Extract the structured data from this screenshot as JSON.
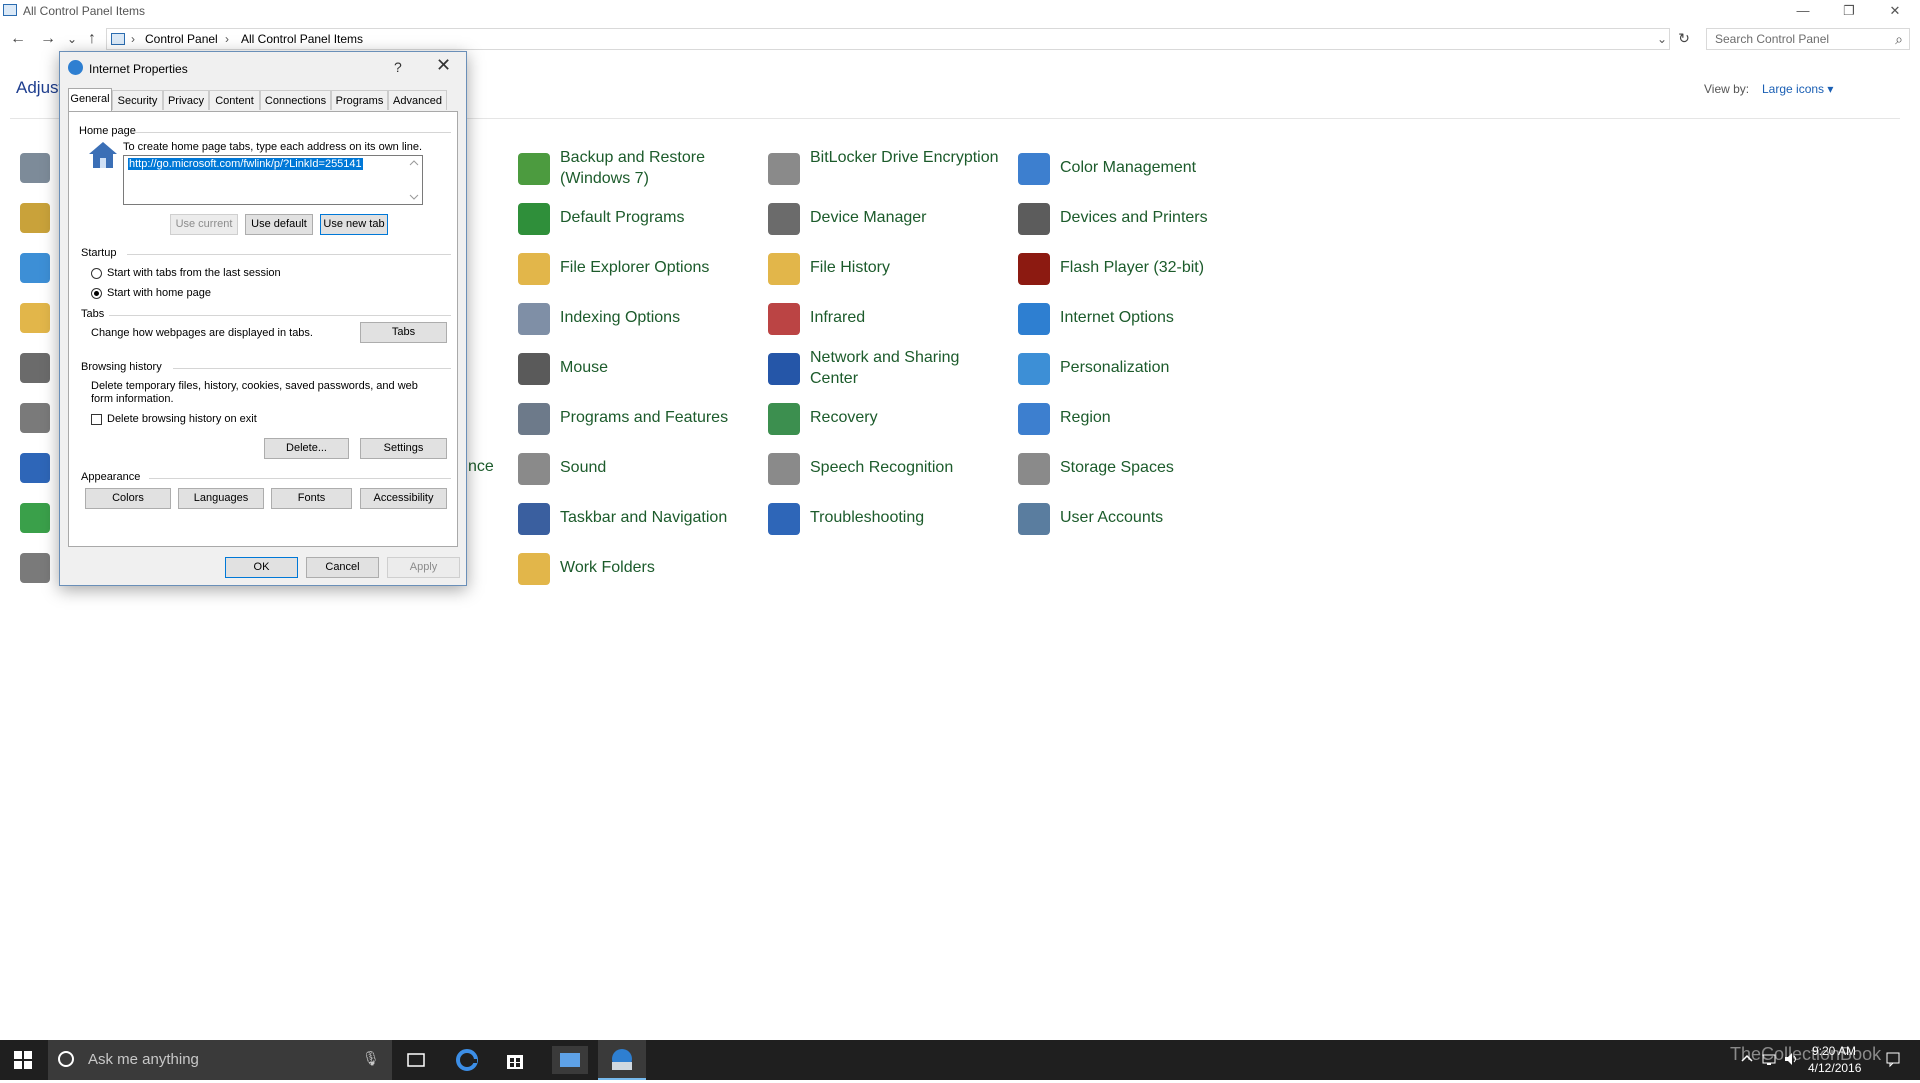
{
  "window": {
    "title": "All Control Panel Items",
    "minimize": "—",
    "restore": "❐",
    "close": "✕"
  },
  "nav": {
    "back": "←",
    "forward": "→",
    "recent": "⌄",
    "up": "↑",
    "refresh": "↻",
    "dropdown": "⌄",
    "breadcrumb": [
      "Control Panel",
      "All Control Panel Items"
    ],
    "breadcrumb_sep": "›"
  },
  "search": {
    "placeholder": "Search Control Panel",
    "icon": "⌕"
  },
  "header": {
    "adjust_label": "Adjust",
    "view_by_label": "View by:",
    "view_by_value": "Large icons",
    "view_by_arrow": "▾"
  },
  "control_panel_items": [
    {
      "label": "Backup and Restore (Windows 7)",
      "icon": "backup-icon",
      "color": "#4c9b3f"
    },
    {
      "label": "BitLocker Drive Encryption",
      "icon": "bitlocker-icon",
      "color": "#8a8a8a"
    },
    {
      "label": "Color Management",
      "icon": "color-management-icon",
      "color": "#3d7fcf"
    },
    {
      "label": "Default Programs",
      "icon": "default-programs-icon",
      "color": "#2f8f3a"
    },
    {
      "label": "Device Manager",
      "icon": "device-manager-icon",
      "color": "#6b6b6b"
    },
    {
      "label": "Devices and Printers",
      "icon": "printer-icon",
      "color": "#5c5c5c"
    },
    {
      "label": "File Explorer Options",
      "icon": "folder-options-icon",
      "color": "#e2b64a"
    },
    {
      "label": "File History",
      "icon": "file-history-icon",
      "color": "#e2b64a"
    },
    {
      "label": "Flash Player (32-bit)",
      "icon": "flash-icon",
      "color": "#8c1a11"
    },
    {
      "label": "Indexing Options",
      "icon": "indexing-icon",
      "color": "#7f8fa6"
    },
    {
      "label": "Infrared",
      "icon": "infrared-icon",
      "color": "#b44"
    },
    {
      "label": "Internet Options",
      "icon": "internet-options-icon",
      "color": "#2e7fd1"
    },
    {
      "label": "Mouse",
      "icon": "mouse-icon",
      "color": "#5a5a5a"
    },
    {
      "label": "Network and Sharing Center",
      "icon": "network-icon",
      "color": "#2556a8"
    },
    {
      "label": "Personalization",
      "icon": "personalization-icon",
      "color": "#3d8fd6"
    },
    {
      "label": "Programs and Features",
      "icon": "programs-icon",
      "color": "#6d7a8a"
    },
    {
      "label": "Recovery",
      "icon": "recovery-icon",
      "color": "#3c8f4f"
    },
    {
      "label": "Region",
      "icon": "region-icon",
      "color": "#3d7fcf"
    },
    {
      "label": "Sound",
      "icon": "sound-icon",
      "color": "#8a8a8a"
    },
    {
      "label": "Speech Recognition",
      "icon": "microphone-icon",
      "color": "#8a8a8a"
    },
    {
      "label": "Storage Spaces",
      "icon": "storage-icon",
      "color": "#8a8a8a"
    },
    {
      "label": "Taskbar and Navigation",
      "icon": "taskbar-icon",
      "color": "#3a5f9f"
    },
    {
      "label": "Troubleshooting",
      "icon": "troubleshooting-icon",
      "color": "#2e66b8"
    },
    {
      "label": "User Accounts",
      "icon": "user-accounts-icon",
      "color": "#5a7d9f"
    },
    {
      "label": "Work Folders",
      "icon": "work-folders-icon",
      "color": "#e2b64a"
    }
  ],
  "hidden_item_fragment": "nce",
  "left_icons": [
    {
      "icon": "admin-tools-icon",
      "color": "#7d8b99"
    },
    {
      "icon": "autoplay-icon",
      "color": "#c9a23a"
    },
    {
      "icon": "display-icon",
      "color": "#3d8fd6"
    },
    {
      "icon": "fonts-icon",
      "color": "#e2b64a"
    },
    {
      "icon": "keyboard-icon",
      "color": "#6b6b6b"
    },
    {
      "icon": "phone-modem-icon",
      "color": "#7a7a7a"
    },
    {
      "icon": "remoteapp-icon",
      "color": "#2e66b8"
    },
    {
      "icon": "sync-center-icon",
      "color": "#3aa04a"
    },
    {
      "icon": "windows-firewall-icon",
      "color": "#7a7a7a"
    }
  ],
  "dialog": {
    "title": "Internet Properties",
    "help": "?",
    "close": "✕",
    "tabs": [
      "General",
      "Security",
      "Privacy",
      "Content",
      "Connections",
      "Programs",
      "Advanced"
    ],
    "home_page": {
      "group_label": "Home page",
      "instruction": "To create home page tabs, type each address on its own line.",
      "url": "http://go.microsoft.com/fwlink/p/?LinkId=255141",
      "use_current": "Use current",
      "use_default": "Use default",
      "use_new_tab": "Use new tab"
    },
    "startup": {
      "group_label": "Startup",
      "option_last_session": "Start with tabs from the last session",
      "option_home_page": "Start with home page"
    },
    "tabs_group": {
      "group_label": "Tabs",
      "description": "Change how webpages are displayed in tabs.",
      "button": "Tabs"
    },
    "browsing_history": {
      "group_label": "Browsing history",
      "description": "Delete temporary files, history, cookies, saved passwords, and web form information.",
      "delete_on_exit": "Delete browsing history on exit",
      "delete_button": "Delete...",
      "settings_button": "Settings"
    },
    "appearance": {
      "group_label": "Appearance",
      "colors": "Colors",
      "languages": "Languages",
      "fonts": "Fonts",
      "accessibility": "Accessibility"
    },
    "ok": "OK",
    "cancel": "Cancel",
    "apply": "Apply"
  },
  "taskbar": {
    "search_placeholder": "Ask me anything",
    "mic": "🎙",
    "time": "9:20 AM",
    "date": "4/12/2016",
    "watermark": "TheCollectionBook"
  }
}
